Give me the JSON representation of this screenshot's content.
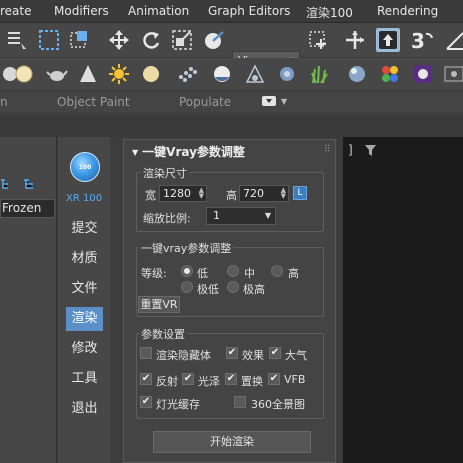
{
  "menubar": {
    "items": [
      "reate",
      "Modifiers",
      "Animation",
      "Graph Editors",
      "渲染100",
      "Rendering"
    ]
  },
  "toolbar": {
    "view_dropdown": "View"
  },
  "ribbon": {
    "tabs": [
      "n",
      "Object Paint",
      "Populate"
    ]
  },
  "left_pane": {
    "frozen_label": "Frozen"
  },
  "nav": {
    "logo_text": "100",
    "title": "XR 100",
    "items": [
      "提交",
      "材质",
      "文件",
      "渲染",
      "修改",
      "工具",
      "退出"
    ],
    "active": "渲染"
  },
  "panel": {
    "title": "一键Vray参数调整",
    "render_size": {
      "title": "渲染尺寸",
      "width_label": "宽",
      "width_value": "1280",
      "height_label": "高",
      "height_value": "720",
      "lock_label": "L",
      "scale_label": "缩放比例:",
      "scale_value": "1"
    },
    "vray_adjust": {
      "title": "一键vray参数调整",
      "level_label": "等级:",
      "levels": [
        "低",
        "中",
        "高",
        "极低",
        "极高"
      ],
      "selected_level": "低",
      "reset_button": "重置VR"
    },
    "params": {
      "title": "参数设置",
      "options": [
        {
          "label": "渲染隐藏体",
          "checked": false
        },
        {
          "label": "效果",
          "checked": true
        },
        {
          "label": "大气",
          "checked": true
        },
        {
          "label": "反射",
          "checked": true
        },
        {
          "label": "光泽",
          "checked": true
        },
        {
          "label": "置换",
          "checked": true
        },
        {
          "label": "VFB",
          "checked": true
        },
        {
          "label": "灯光缓存",
          "checked": true
        },
        {
          "label": "360全景图",
          "checked": false
        }
      ]
    },
    "start_button": "开始渲染"
  },
  "colors": {
    "accent_blue": "#5a8fc8",
    "logo_blue": "#3f9be6",
    "xr_label": "#56aef7",
    "panel_bg": "#444444",
    "viewport_bg": "#1b1b1b"
  }
}
